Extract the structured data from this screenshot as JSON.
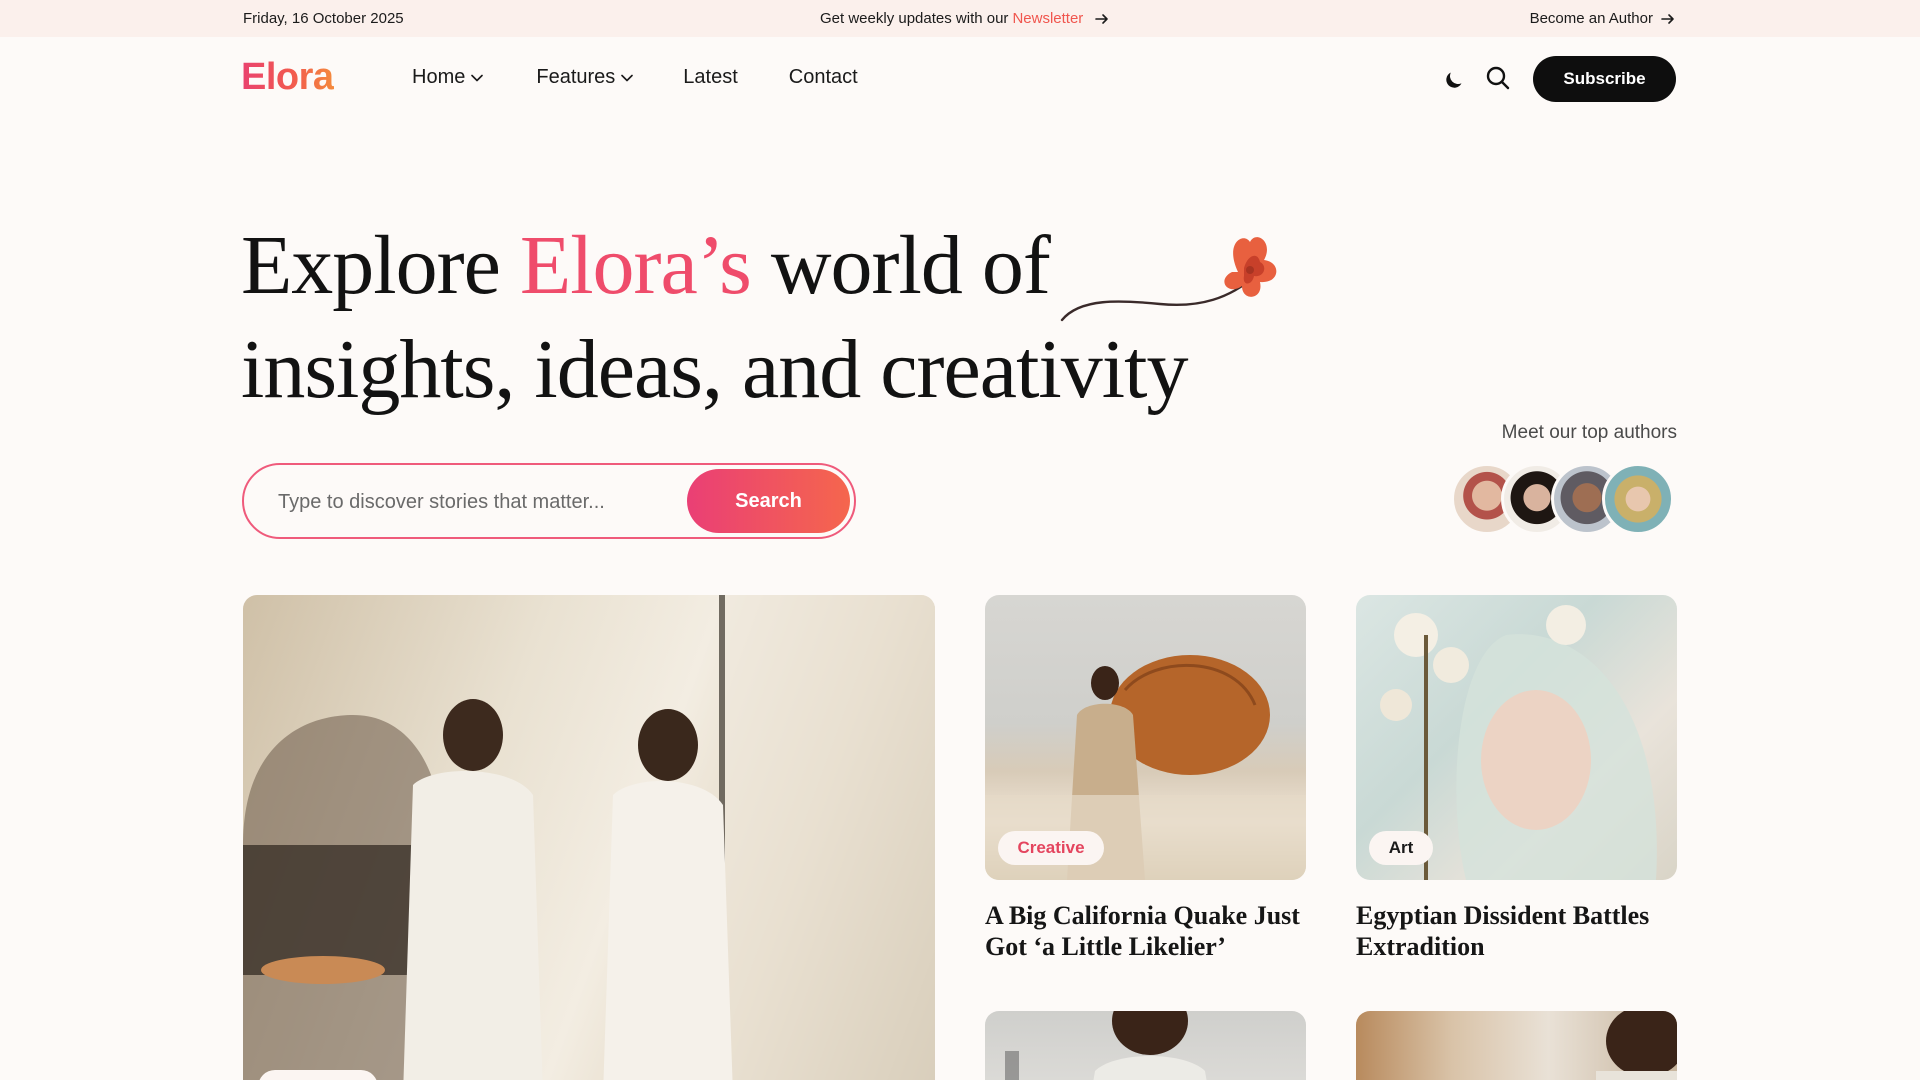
{
  "topbar": {
    "date": "Friday, 16 October 2025",
    "promo_text": "Get weekly updates with our",
    "newsletter_link": "Newsletter",
    "author_link": "Become an Author"
  },
  "header": {
    "logo": "Elora",
    "nav": [
      {
        "label": "Home",
        "has_dropdown": true
      },
      {
        "label": "Features",
        "has_dropdown": true
      },
      {
        "label": "Latest",
        "has_dropdown": false
      },
      {
        "label": "Contact",
        "has_dropdown": false
      }
    ],
    "theme_toggle_icon": "moon-icon",
    "search_icon": "search-icon",
    "subscribe_label": "Subscribe"
  },
  "hero": {
    "title_part1": "Explore ",
    "title_accent": "Elora’s",
    "title_part2": " world of",
    "title_line2": "insights, ideas, and creativity",
    "search_placeholder": "Type to discover stories that matter...",
    "search_button": "Search",
    "authors_label": "Meet our top authors"
  },
  "posts": [
    {
      "category": "Creative",
      "title": "A Big California Quake Just Got ‘a Little Likelier’"
    },
    {
      "category": "Art",
      "title": "Egyptian Dissident Battles Extradition"
    }
  ],
  "colors": {
    "accent": "#ef4c6b",
    "accent_orange": "#f5664d",
    "topbar_bg": "#fbf0ec",
    "page_bg": "#fdfaf8",
    "button_dark": "#0e0e0e"
  }
}
